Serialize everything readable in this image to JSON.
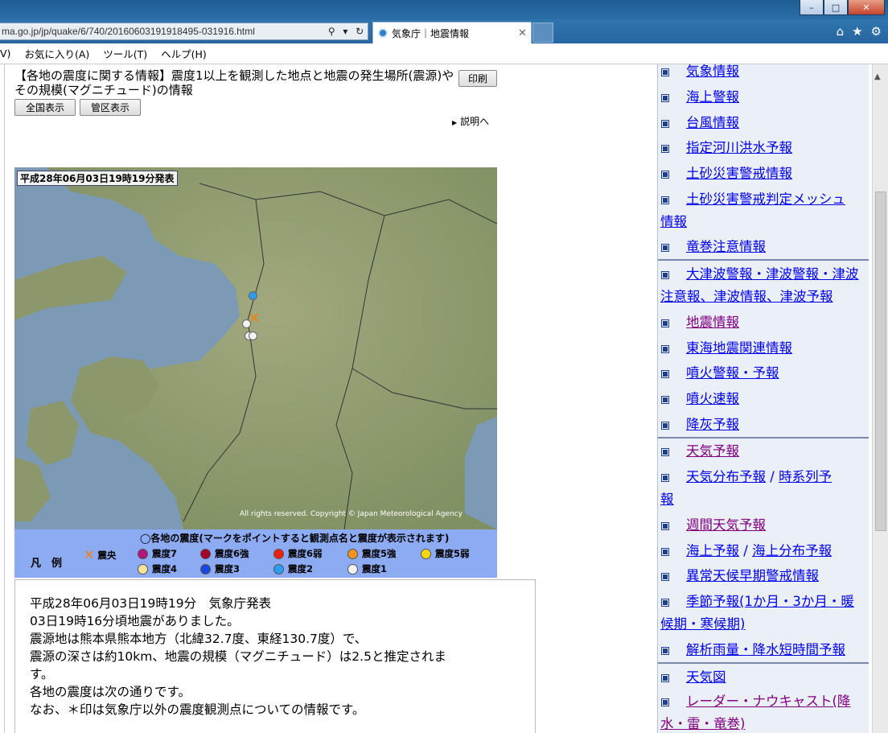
{
  "browser": {
    "address": "ma.go.jp/jp/quake/6/740/20160603191918495-031916.html",
    "tab_title": "気象庁｜地震情報",
    "menu": [
      "V)",
      "お気に入り(A)",
      "ツール(T)",
      "ヘルプ(H)"
    ],
    "window_buttons": [
      "–",
      "□",
      "✕"
    ]
  },
  "page": {
    "heading": "【各地の震度に関する情報】震度1以上を観測した地点と地震の発生場所(震源)やその規模(マグニチュード)の情報",
    "print_button": "印刷",
    "view_buttons": [
      "全国表示",
      "管区表示"
    ],
    "explain_link": "説明へ",
    "map": {
      "issued_label": "平成28年06月03日19時19分発表",
      "copyright": "All rights reserved. Copyright © Japan Meteorological Agency",
      "stations": [
        {
          "intensity": "震度2",
          "color": "#2b9df0"
        },
        {
          "intensity": "震度1",
          "color": "#f2f2f2"
        },
        {
          "intensity": "震度1",
          "color": "#f2f2f2"
        },
        {
          "intensity": "震度1",
          "color": "#f2f2f2"
        }
      ]
    },
    "legend": {
      "label": "凡　例",
      "title": "◯各地の震度(マークをポイントすると観測点名と震度が表示されます)",
      "epicenter": "震央",
      "items": [
        {
          "label": "震度7",
          "color": "#b0167e"
        },
        {
          "label": "震度6強",
          "color": "#a3002b"
        },
        {
          "label": "震度6弱",
          "color": "#f21f0e"
        },
        {
          "label": "震度5強",
          "color": "#f7931e"
        },
        {
          "label": "震度5弱",
          "color": "#f8d906"
        },
        {
          "label": "震度4",
          "color": "#fbe39c"
        },
        {
          "label": "震度3",
          "color": "#1847e5"
        },
        {
          "label": "震度2",
          "color": "#2b9df0"
        },
        {
          "label": "震度1",
          "color": "#f2f2f2"
        }
      ]
    },
    "text_lines": [
      "平成28年06月03日19時19分　気象庁発表",
      "03日19時16分頃地震がありました。",
      "震源地は熊本県熊本地方（北緯32.7度、東経130.7度）で、",
      "震源の深さは約10km、地震の規模（マグニチュード）は2.5と推定されま",
      "す。",
      "各地の震度は次の通りです。",
      "なお、＊印は気象庁以外の震度観測点についての情報です。"
    ]
  },
  "sidebar": {
    "items": [
      {
        "line1": "気象情報",
        "line2": "",
        "visited": false
      },
      {
        "line1": "海上警報",
        "line2": "",
        "visited": false
      },
      {
        "line1": "台風情報",
        "line2": "",
        "visited": false
      },
      {
        "line1": "指定河川洪水予報",
        "line2": "",
        "visited": false
      },
      {
        "line1": "土砂災害警戒情報",
        "line2": "",
        "visited": false
      },
      {
        "line1": "土砂災害警戒判定メッシュ",
        "line2": "情報",
        "visited": false
      },
      {
        "line1": "竜巻注意情報",
        "line2": "",
        "visited": false
      },
      {
        "line1": "大津波警報・津波警報・津波",
        "line2": "注意報、津波情報、津波予報",
        "visited": false
      },
      {
        "line1": "地震情報",
        "line2": "",
        "visited": true
      },
      {
        "line1": "東海地震関連情報",
        "line2": "",
        "visited": false
      },
      {
        "line1": "噴火警報・予報",
        "line2": "",
        "visited": false
      },
      {
        "line1": "噴火速報",
        "line2": "",
        "visited": false
      },
      {
        "line1": "降灰予報",
        "line2": "",
        "visited": false
      },
      {
        "line1": "天気予報",
        "line2": "",
        "visited": true
      },
      {
        "line1": "天気分布予報",
        "line1b": "時系列予",
        "line2": "報",
        "visited": false
      },
      {
        "line1": "週間天気予報",
        "line2": "",
        "visited": true
      },
      {
        "line1": "海上予報",
        "line1b": "海上分布予報",
        "line2": "",
        "visited": false
      },
      {
        "line1": "異常天候早期警戒情報",
        "line2": "",
        "visited": false
      },
      {
        "line1": "季節予報(1か月・3か月・暖",
        "line2": "候期・寒候期)",
        "visited": false
      },
      {
        "line1": "解析雨量・降水短時間予報",
        "line2": "",
        "visited": false
      },
      {
        "line1": "天気図",
        "line2": "",
        "visited": false
      },
      {
        "line1": "レーダー・ナウキャスト(降",
        "line2": "水・雷・竜巻)",
        "visited": true
      }
    ]
  }
}
